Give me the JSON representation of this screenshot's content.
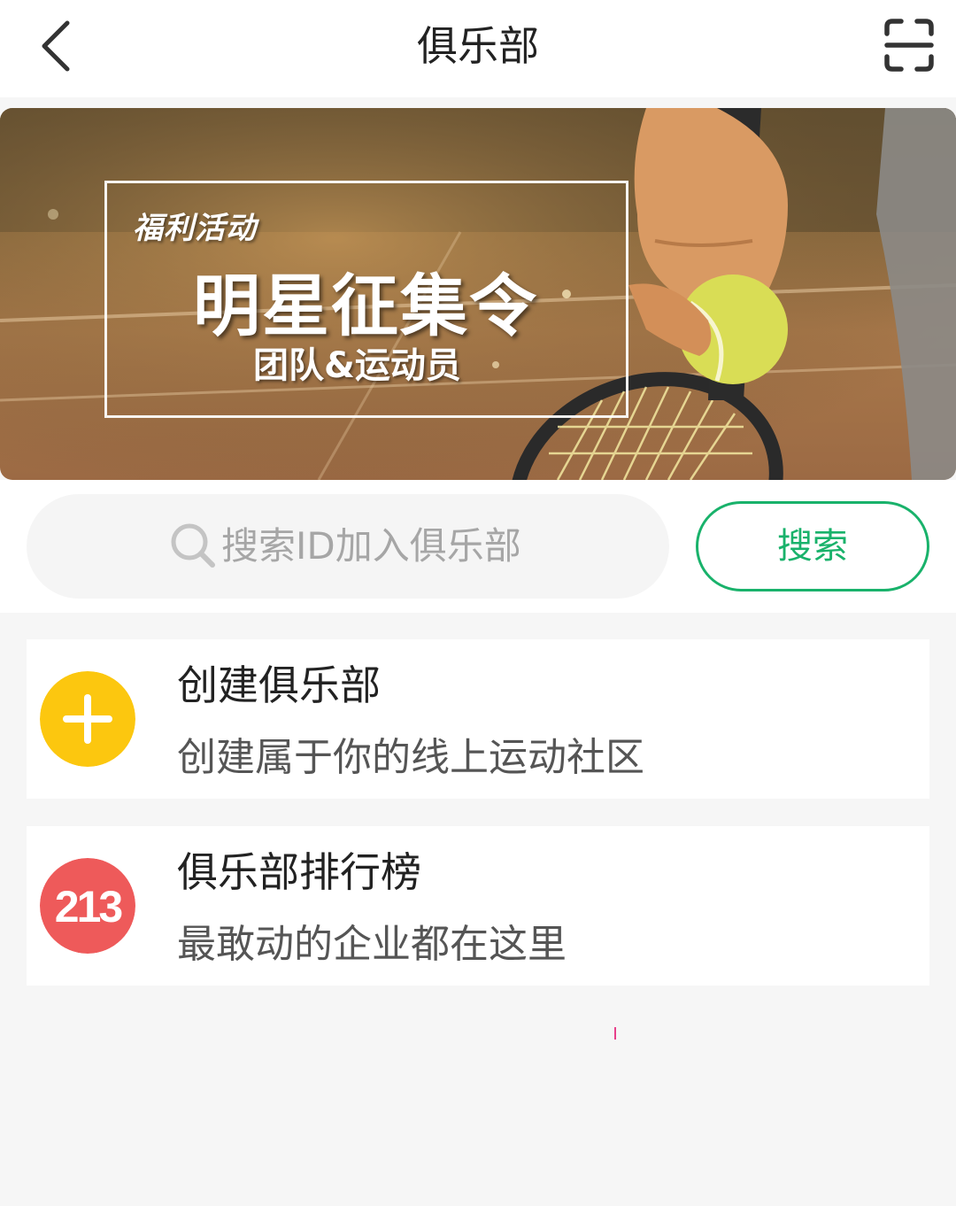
{
  "header": {
    "title": "俱乐部",
    "back_icon": "chevron-left-icon",
    "scan_icon": "scan-icon"
  },
  "banner": {
    "tag": "福利活动",
    "headline": "明星征集令",
    "subline": "团队&运动员"
  },
  "search": {
    "placeholder": "搜索ID加入俱乐部",
    "button_label": "搜索",
    "accent_color": "#19b26b"
  },
  "cards": [
    {
      "title": "创建俱乐部",
      "description": "创建属于你的线上运动社区",
      "icon": "plus-icon",
      "icon_color": "#fcc70f"
    },
    {
      "title": "俱乐部排行榜",
      "description": "最敢动的企业都在这里",
      "icon": "ranking-icon",
      "icon_text": "213",
      "icon_color": "#ee5a5a"
    }
  ]
}
